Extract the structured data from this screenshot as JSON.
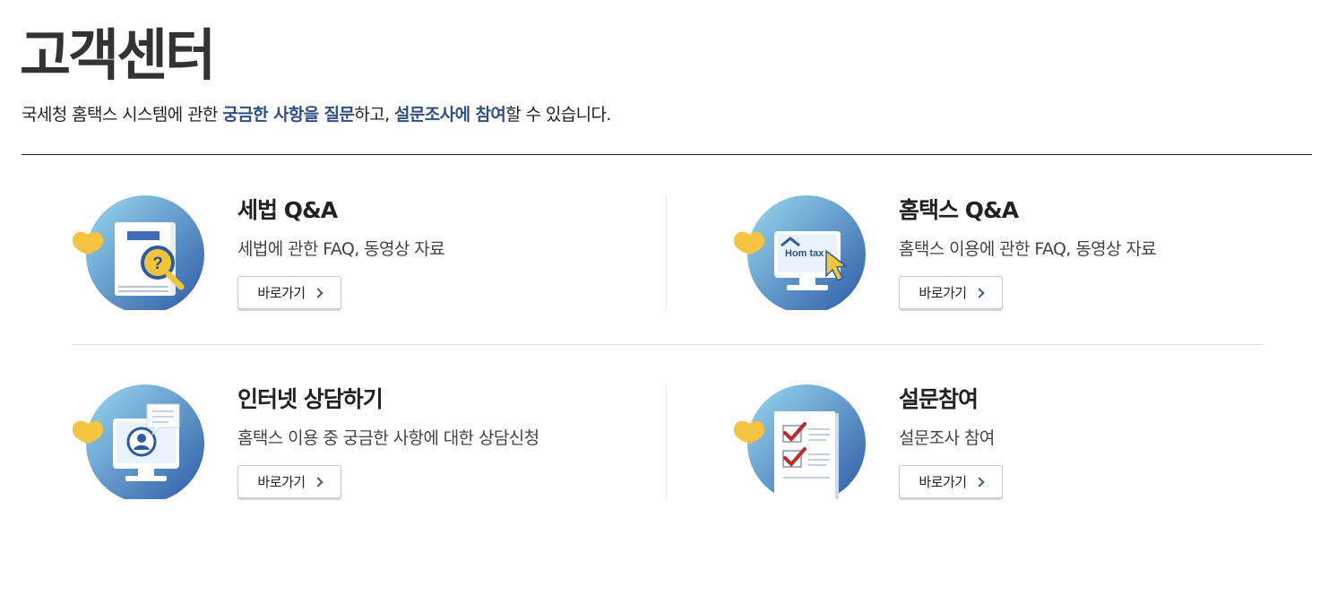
{
  "header": {
    "title": "고객센터",
    "desc_part1": "국세청 홈택스 시스템에 관한 ",
    "desc_hl1": "궁금한 사항을 질문",
    "desc_part2": "하고, ",
    "desc_hl2": "설문조사에 참여",
    "desc_part3": "할 수 있습니다."
  },
  "cards": [
    {
      "title": "세법 Q&A",
      "desc": "세법에 관한 FAQ, 동영상 자료",
      "button": "바로가기",
      "icon": "tax-law-book-icon"
    },
    {
      "title": "홈택스 Q&A",
      "desc": "홈택스 이용에 관한 FAQ, 동영상 자료",
      "button": "바로가기",
      "icon": "hometax-monitor-icon"
    },
    {
      "title": "인터넷 상담하기",
      "desc": "홈택스 이용 중 궁금한 사항에 대한 상담신청",
      "button": "바로가기",
      "icon": "online-consult-icon"
    },
    {
      "title": "설문참여",
      "desc": "설문조사 참여",
      "button": "바로가기",
      "icon": "survey-checklist-icon"
    }
  ],
  "icon_text": {
    "hometax_logo": "Hom  tax"
  },
  "colors": {
    "accent_text": "#2f4f86",
    "icon_circle_light": "#8fd3ec",
    "icon_circle_dark": "#2f5ea8",
    "heart_yellow": "#f5c342",
    "check_red": "#c0282c"
  }
}
